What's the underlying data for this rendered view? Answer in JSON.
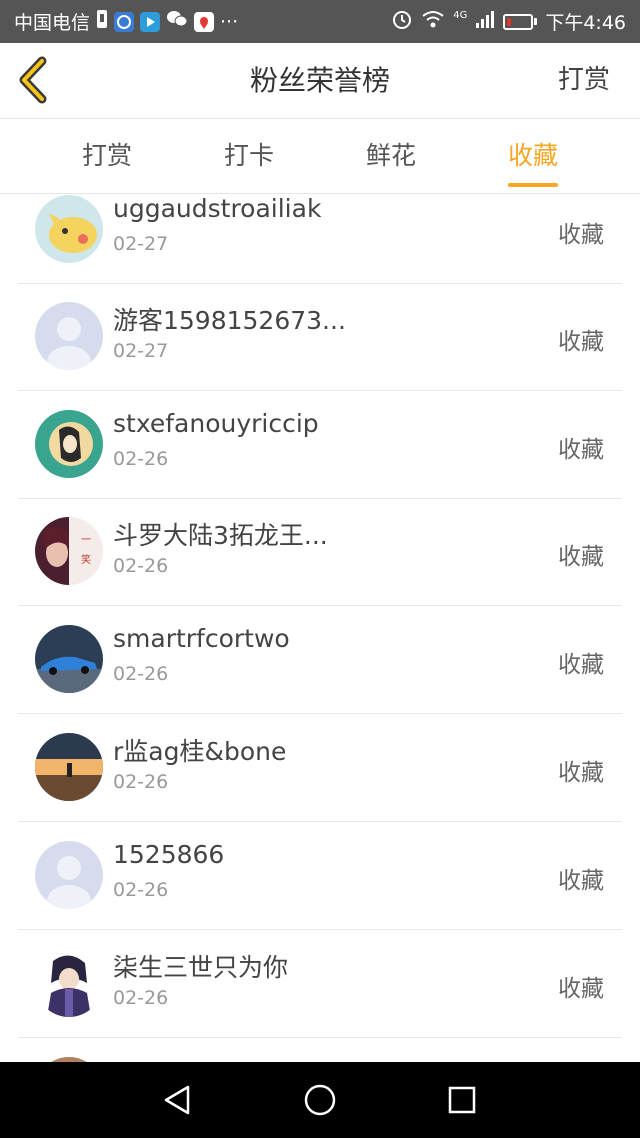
{
  "status_bar": {
    "carrier": "中国电信",
    "network": "4G",
    "time": "下午4:46",
    "dots": "···"
  },
  "header": {
    "title": "粉丝荣誉榜",
    "action_label": "打赏"
  },
  "tabs": [
    {
      "label": "打赏",
      "active": false
    },
    {
      "label": "打卡",
      "active": false
    },
    {
      "label": "鲜花",
      "active": false
    },
    {
      "label": "收藏",
      "active": true
    }
  ],
  "colors": {
    "accent": "#f5a623",
    "status_bar_bg": "#555555",
    "nav_bar_bg": "#000000",
    "battery_low": "#e0342e"
  },
  "list": [
    {
      "name": "uggaudstroailiak",
      "date": "02-27",
      "action": "收藏",
      "avatar": "pikachu-avatar"
    },
    {
      "name": "游客1598152673...",
      "date": "02-27",
      "action": "收藏",
      "avatar": "default-user-avatar"
    },
    {
      "name": "stxefanouyriccip",
      "date": "02-26",
      "action": "收藏",
      "avatar": "girl-moon-avatar"
    },
    {
      "name": "斗罗大陆3拓龙王...",
      "date": "02-26",
      "action": "收藏",
      "avatar": "girl-portrait-avatar"
    },
    {
      "name": "smartrfcortwo",
      "date": "02-26",
      "action": "收藏",
      "avatar": "blue-car-avatar"
    },
    {
      "name": "r监ag桂&bone",
      "date": "02-26",
      "action": "收藏",
      "avatar": "sunset-avatar"
    },
    {
      "name": "1525866",
      "date": "02-26",
      "action": "收藏",
      "avatar": "default-user-avatar"
    },
    {
      "name": "柒生三世只为你",
      "date": "02-26",
      "action": "收藏",
      "avatar": "anime-character-avatar"
    }
  ],
  "nav_bar": {
    "back": "back-triangle-icon",
    "home": "home-circle-icon",
    "recents": "recents-square-icon"
  }
}
